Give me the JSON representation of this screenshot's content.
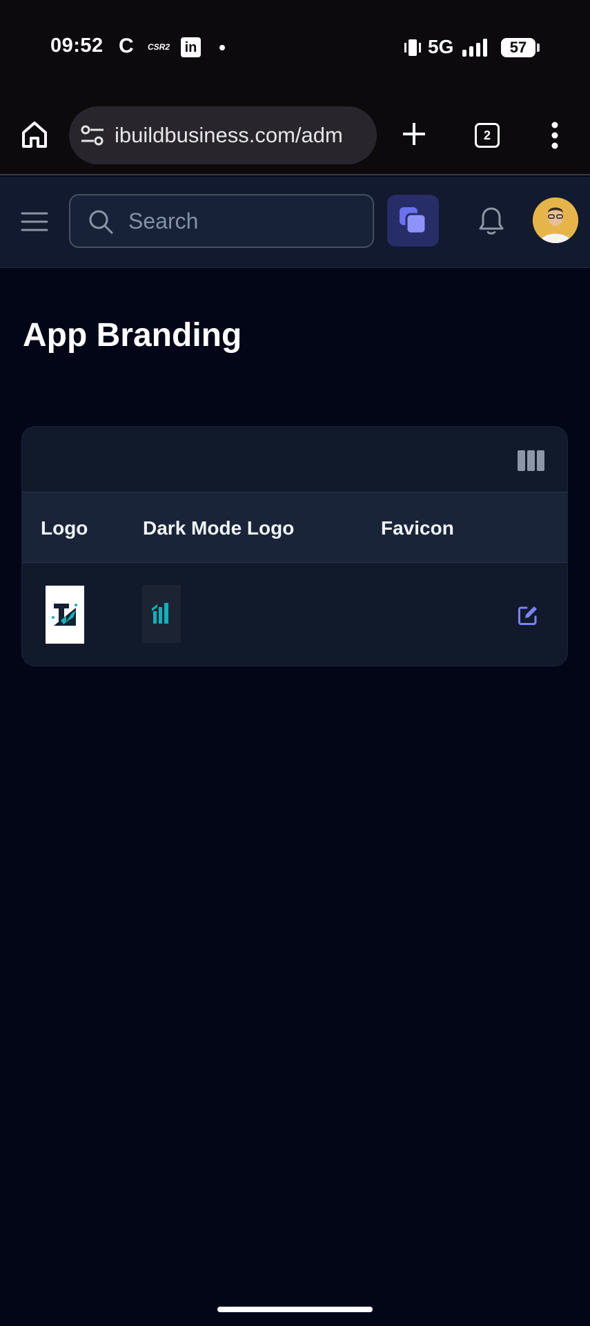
{
  "status_bar": {
    "time": "09:52",
    "notification_c": "C",
    "notification_csr": "CSR2",
    "notification_li": "in",
    "network": "5G",
    "battery": "57"
  },
  "browser": {
    "url": "ibuildbusiness.com/adm",
    "tab_count": "2"
  },
  "header": {
    "search_placeholder": "Search"
  },
  "page": {
    "title": "App Branding"
  },
  "table": {
    "columns": [
      "Logo",
      "Dark Mode Logo",
      "Favicon"
    ]
  },
  "colors": {
    "background": "#020617",
    "card": "#111a2b",
    "header_row": "#1a2438",
    "accent": "#7c83f5",
    "brand_teal": "#12b0b7"
  }
}
